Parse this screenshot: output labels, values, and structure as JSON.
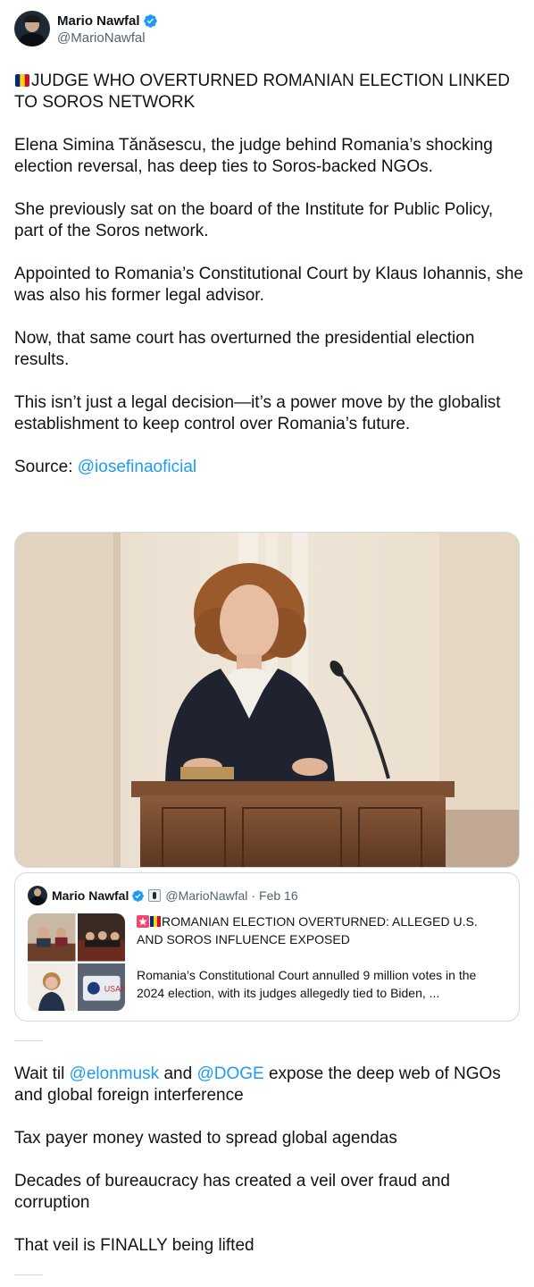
{
  "author": {
    "name": "Mario Nawfal",
    "handle": "@MarioNawfal"
  },
  "tweet": {
    "headline": "JUDGE WHO OVERTURNED ROMANIAN ELECTION LINKED TO SOROS NETWORK",
    "paragraphs": [
      "Elena Simina Tănăsescu, the judge behind Romania’s shocking election reversal, has deep ties to Soros-backed NGOs.",
      "She previously sat on the board of the Institute for Public Policy, part of the Soros network.",
      "Appointed to Romania’s Constitutional Court by Klaus Iohannis, she was also his former legal advisor.",
      "Now, that same court has overturned the presidential election results.",
      "This isn’t just a legal decision—it’s a power move by the globalist establishment to keep control over Romania’s future."
    ],
    "source_label": "Source: ",
    "source_link": "@iosefinaoficial"
  },
  "quote": {
    "name": "Mario Nawfal",
    "handle": "@MarioNawfal",
    "separator": "·",
    "date": "Feb 16",
    "title": "ROMANIAN ELECTION OVERTURNED: ALLEGED U.S. AND SOROS INFLUENCE EXPOSED",
    "body": "Romania’s Constitutional Court annulled 9 million votes in the 2024 election, with its judges allegedly tied to Biden, ...",
    "usaid_label": "USAID"
  },
  "reply": {
    "line1_pre": "Wait til ",
    "mention1": "@elonmusk",
    "line1_mid": " and ",
    "mention2": "@DOGE",
    "line1_post": " expose the deep web of NGOs and global foreign interference",
    "line2": "Tax payer money wasted to spread global agendas",
    "line3": "Decades of bureaucracy has created a veil over fraud and corruption",
    "line4": "That veil is FINALLY being lifted"
  },
  "colors": {
    "link": "#1d9bf0",
    "verified": "#1d9bf0",
    "text": "#0f1419",
    "muted": "#536471",
    "border": "#cfd9de"
  },
  "icons": [
    "verified-badge-icon",
    "romania-flag-icon",
    "siren-icon",
    "affiliate-badge-icon"
  ]
}
